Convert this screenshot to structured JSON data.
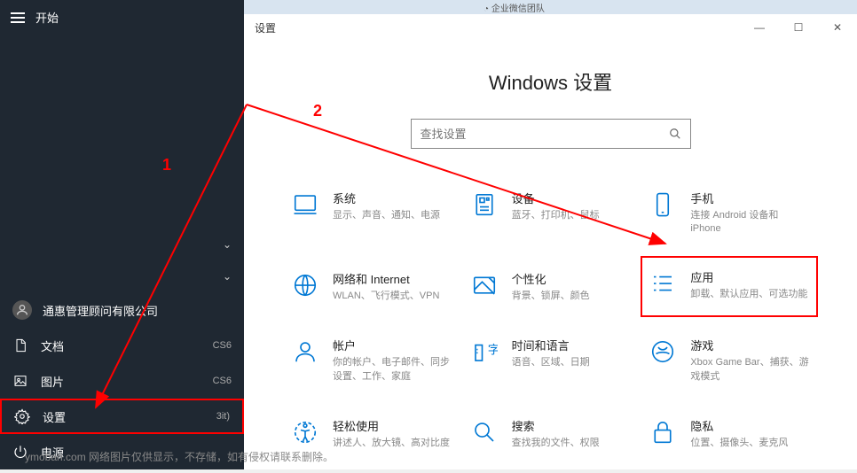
{
  "start": {
    "title": "开始",
    "user": "通惠管理顾问有限公司",
    "recent_suffix_1": "CS6",
    "recent_suffix_2": "CS6",
    "recent_suffix_3": "3it)",
    "items": {
      "documents": "文档",
      "pictures": "图片",
      "settings": "设置",
      "power": "电源"
    }
  },
  "tabstrip": {
    "item1": "企业微信团队"
  },
  "settings": {
    "window_title": "设置",
    "heading": "Windows 设置",
    "search_placeholder": "查找设置",
    "tiles": {
      "system": {
        "title": "系统",
        "sub": "显示、声音、通知、电源"
      },
      "devices": {
        "title": "设备",
        "sub": "蓝牙、打印机、鼠标"
      },
      "phone": {
        "title": "手机",
        "sub": "连接 Android 设备和 iPhone"
      },
      "network": {
        "title": "网络和 Internet",
        "sub": "WLAN、飞行模式、VPN"
      },
      "personalization": {
        "title": "个性化",
        "sub": "背景、锁屏、颜色"
      },
      "apps": {
        "title": "应用",
        "sub": "卸载、默认应用、可选功能"
      },
      "accounts": {
        "title": "帐户",
        "sub": "你的帐户、电子邮件、同步设置、工作、家庭"
      },
      "time": {
        "title": "时间和语言",
        "sub": "语音、区域、日期"
      },
      "gaming": {
        "title": "游戏",
        "sub": "Xbox Game Bar、捕获、游戏模式"
      },
      "ease": {
        "title": "轻松使用",
        "sub": "讲述人、放大镜、高对比度"
      },
      "search": {
        "title": "搜索",
        "sub": "查找我的文件、权限"
      },
      "privacy": {
        "title": "隐私",
        "sub": "位置、摄像头、麦克风"
      }
    }
  },
  "annotations": {
    "label1": "1",
    "label2": "2"
  },
  "watermark": "ymoban.com 网络图片仅供显示，不存储，如有侵权请联系删除。"
}
